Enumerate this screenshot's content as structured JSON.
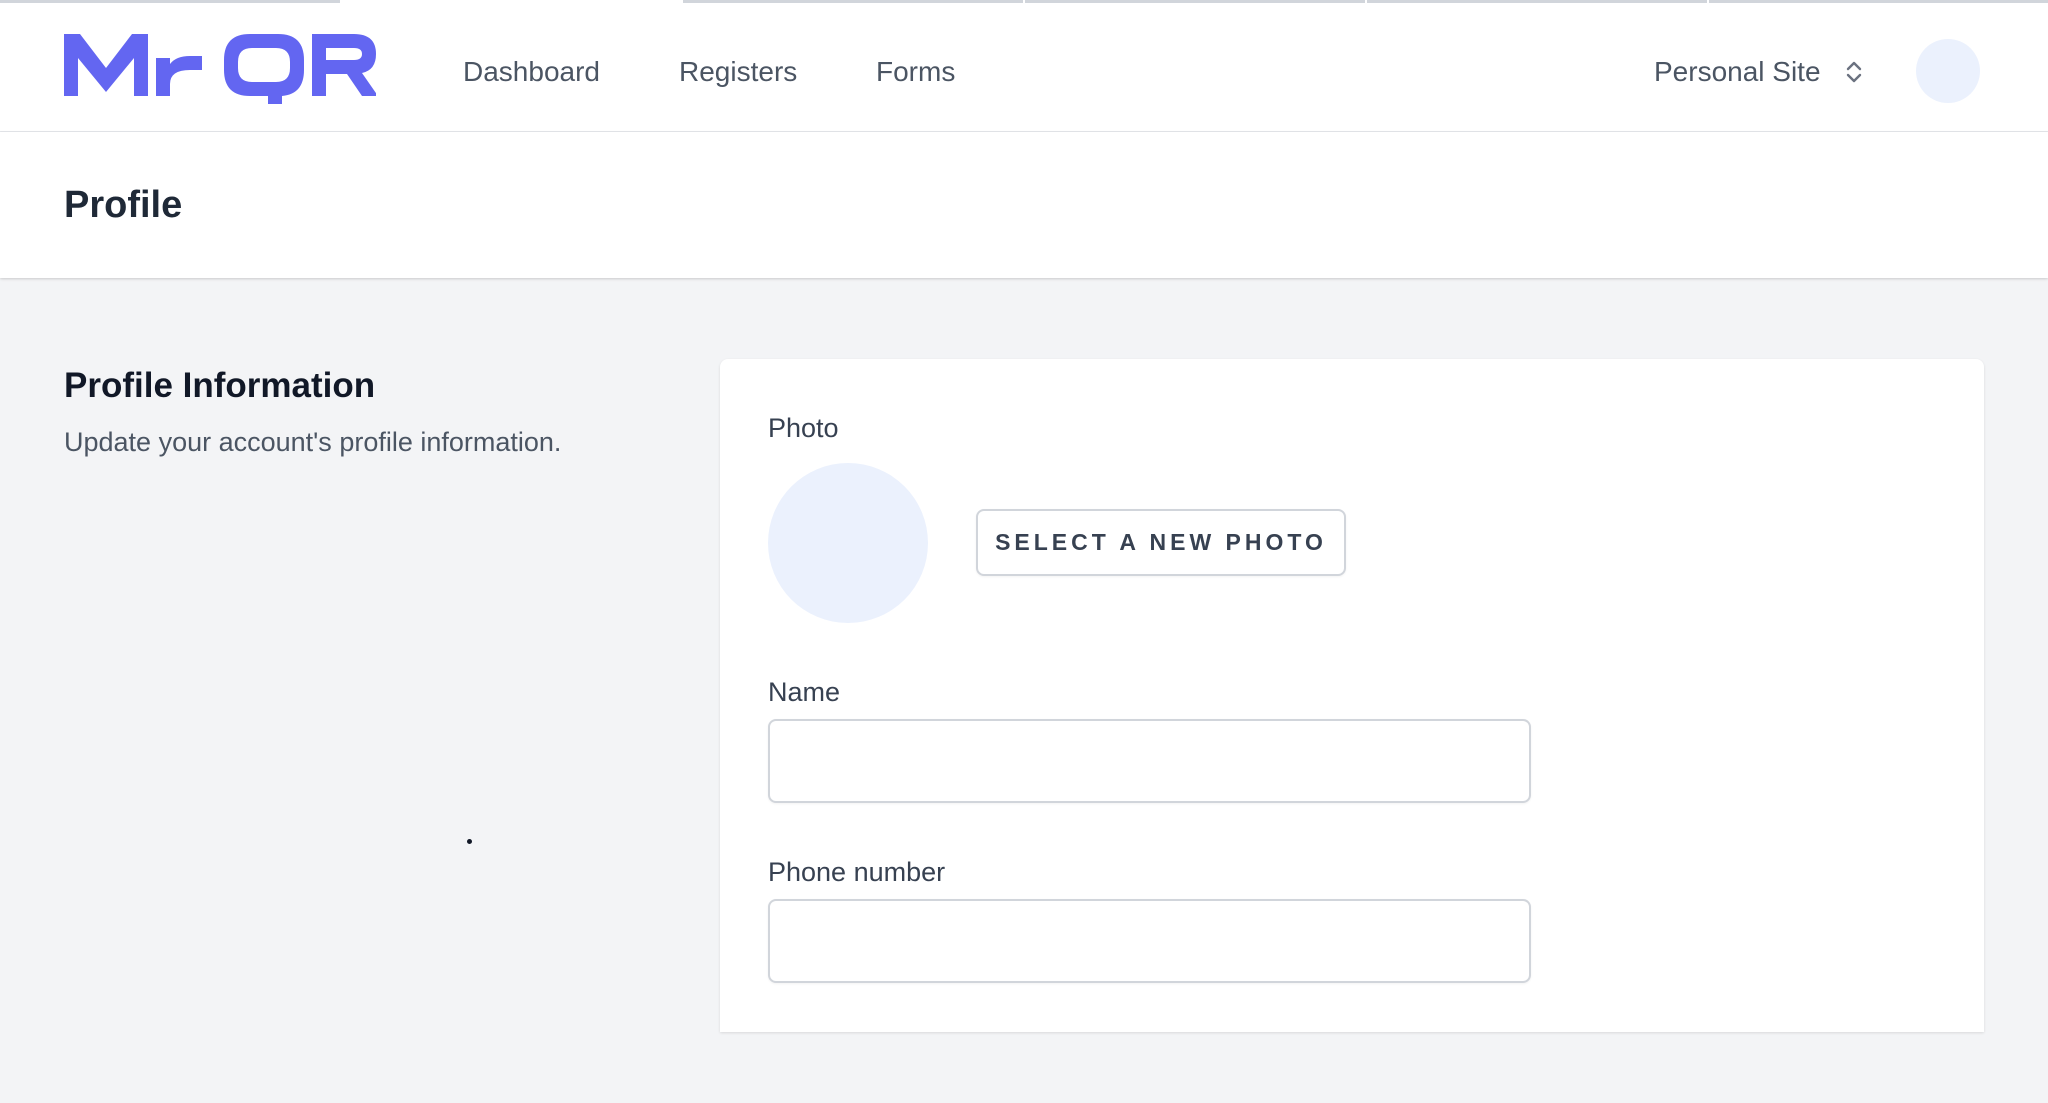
{
  "brand": {
    "logo_text": "MrQR",
    "accent_color": "#6366f1"
  },
  "nav": {
    "links": [
      {
        "label": "Dashboard"
      },
      {
        "label": "Registers"
      },
      {
        "label": "Forms"
      }
    ],
    "site_switcher": {
      "label": "Personal Site",
      "icon": "chevron-up-down-icon"
    },
    "avatar_icon": "user-avatar"
  },
  "page": {
    "title": "Profile"
  },
  "profile_section": {
    "title": "Profile Information",
    "description": "Update your account's profile information.",
    "photo_label": "Photo",
    "select_photo_label": "SELECT A NEW PHOTO",
    "name_label": "Name",
    "name_value": "",
    "phone_label": "Phone number",
    "phone_value": ""
  }
}
